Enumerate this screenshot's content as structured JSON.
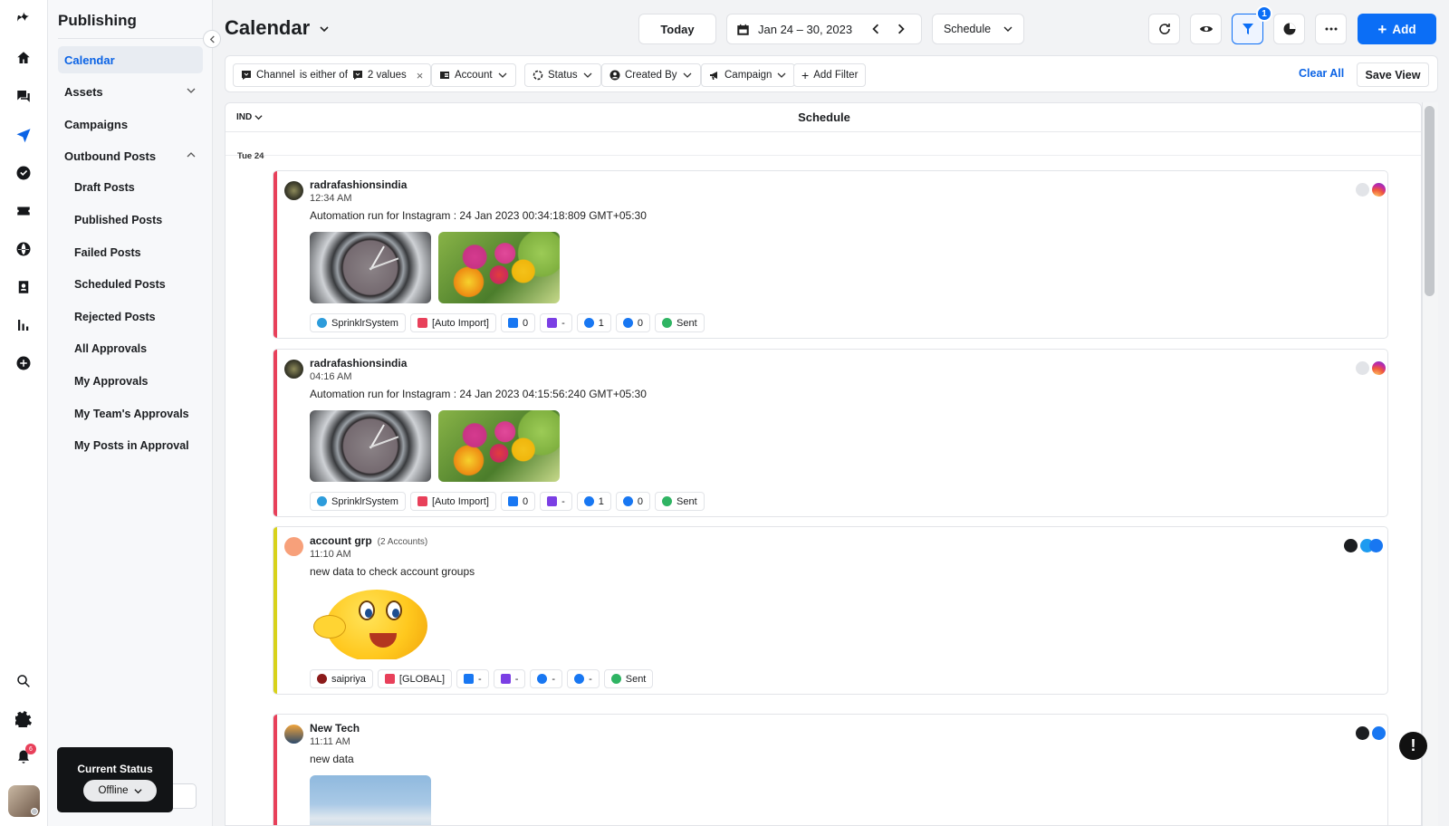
{
  "app": {
    "section_title": "Publishing"
  },
  "sidebar": {
    "items": [
      {
        "label": "Calendar"
      },
      {
        "label": "Assets"
      },
      {
        "label": "Campaigns"
      },
      {
        "label": "Outbound Posts"
      }
    ],
    "subitems": [
      {
        "label": "Draft Posts"
      },
      {
        "label": "Published Posts"
      },
      {
        "label": "Failed Posts"
      },
      {
        "label": "Scheduled Posts"
      },
      {
        "label": "Rejected Posts"
      },
      {
        "label": "All Approvals"
      },
      {
        "label": "My Approvals"
      },
      {
        "label": "My Team's Approvals"
      },
      {
        "label": "My Posts in Approval"
      }
    ]
  },
  "status_popup": {
    "label": "Current Status",
    "value": "Offline"
  },
  "notifications": {
    "count": "6"
  },
  "header": {
    "title": "Calendar",
    "today_label": "Today",
    "date_range": "Jan 24 – 30, 2023",
    "view_label": "Schedule",
    "filter_badge": "1",
    "add_label": "Add"
  },
  "filters": {
    "channel": {
      "field": "Channel",
      "operator": "is either of",
      "value": "2 values"
    },
    "chips": [
      {
        "label": "Account"
      },
      {
        "label": "Status"
      },
      {
        "label": "Created By"
      },
      {
        "label": "Campaign"
      }
    ],
    "add_filter": "Add Filter",
    "clear_all": "Clear All",
    "save_view": "Save View"
  },
  "schedule": {
    "timezone": "IND",
    "title": "Schedule",
    "day_label": "Tue 24",
    "posts": [
      {
        "account": "radrafashionsindia",
        "time": "12:34 AM",
        "text": "Automation run for Instagram : 24 Jan 2023 00:34:18:809 GMT+05:30",
        "creator": "SprinklrSystem",
        "campaign": "[Auto Import]",
        "likes": "0",
        "tags": "-",
        "views": "1",
        "comments": "0",
        "status": "Sent",
        "accent": "#e8405a",
        "networks": [
          "generic-icon",
          "instagram-icon"
        ]
      },
      {
        "account": "radrafashionsindia",
        "time": "04:16 AM",
        "text": "Automation run for Instagram : 24 Jan 2023 04:15:56:240 GMT+05:30",
        "creator": "SprinklrSystem",
        "campaign": "[Auto Import]",
        "likes": "0",
        "tags": "-",
        "views": "1",
        "comments": "0",
        "status": "Sent",
        "accent": "#e8405a",
        "networks": [
          "generic-icon",
          "instagram-icon"
        ]
      },
      {
        "account": "account grp",
        "account_count": "(2 Accounts)",
        "time": "11:10 AM",
        "text": "new data to check account groups",
        "creator": "saipriya",
        "campaign": "[GLOBAL]",
        "likes": "-",
        "tags": "-",
        "views": "-",
        "comments": "-",
        "status": "Sent",
        "accent": "#d8d21a",
        "networks": [
          "generic-icon",
          "twitter-icon",
          "facebook-icon"
        ]
      },
      {
        "account": "New Tech",
        "time": "11:11 AM",
        "text": "new data",
        "accent": "#e8405a",
        "networks": [
          "generic-icon",
          "facebook-icon"
        ]
      }
    ]
  },
  "colors": {
    "primary": "#0b6ef6",
    "active_nav": "#0b63e5",
    "sent_green": "#2fb463"
  }
}
